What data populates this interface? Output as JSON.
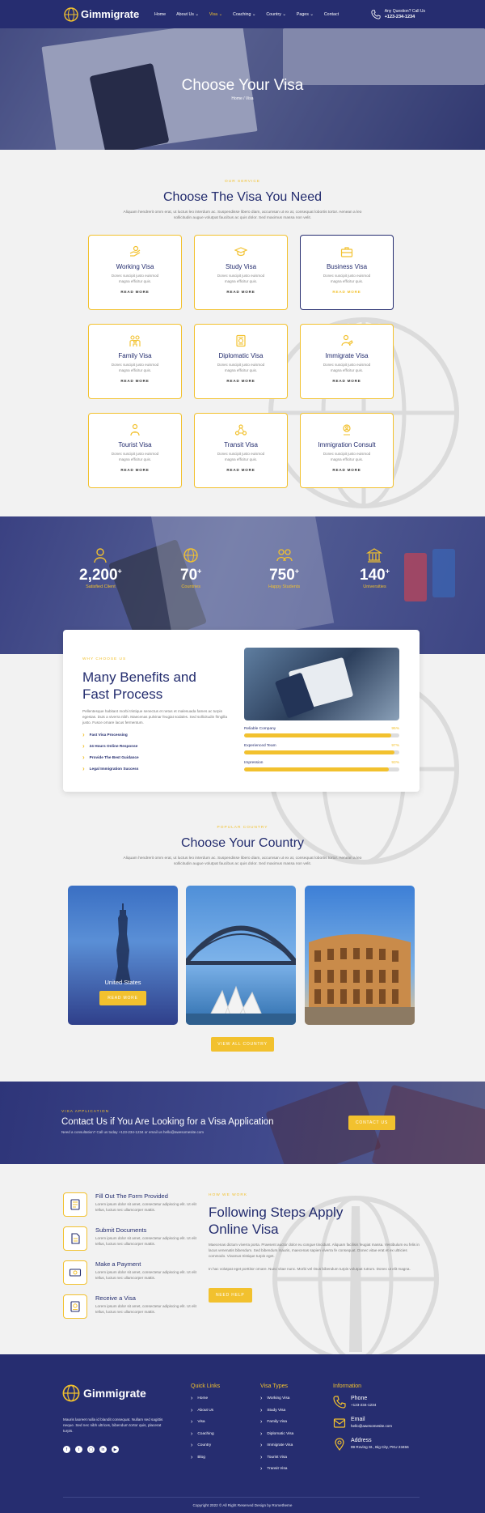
{
  "header": {
    "logo_text": "Gimmigrate",
    "nav": [
      {
        "label": "Home",
        "caret": false,
        "active": false
      },
      {
        "label": "About Us",
        "caret": true,
        "active": false
      },
      {
        "label": "Visa",
        "caret": true,
        "active": true
      },
      {
        "label": "Coaching",
        "caret": true,
        "active": false
      },
      {
        "label": "Country",
        "caret": true,
        "active": false
      },
      {
        "label": "Pages",
        "caret": true,
        "active": false
      },
      {
        "label": "Contact",
        "caret": false,
        "active": false
      }
    ],
    "call_label": "Any Question? Call Us",
    "call_number": "+123-234-1234"
  },
  "hero": {
    "title": "Choose Your Visa",
    "breadcrumb": "Home / Visa"
  },
  "services": {
    "eyebrow": "OUR SERVICE",
    "title": "Choose The Visa You Need",
    "desc": "Aliquam hendrerit omm erat, ut luctus leo interdum ac. Suspendisse libero diam, accumsan ut ex at, consequat lobortis tortor. Aenean a leo sollicitudin augue volutpat faucibus ac quis dolor. Sed maximus massa non velit.",
    "card_desc": "Donec suscipit justo euismod magna efficitur quis.",
    "read_more": "READ MORE",
    "cards": [
      {
        "title": "Working Visa",
        "icon": "hand-icon"
      },
      {
        "title": "Study Visa",
        "icon": "graduation-cap-icon"
      },
      {
        "title": "Business Visa",
        "icon": "briefcase-icon"
      },
      {
        "title": "Family Visa",
        "icon": "family-icon"
      },
      {
        "title": "Diplomatic Visa",
        "icon": "document-icon"
      },
      {
        "title": "Immigrate Visa",
        "icon": "handshake-icon"
      },
      {
        "title": "Tourist Visa",
        "icon": "tourist-icon"
      },
      {
        "title": "Transit Visa",
        "icon": "transit-icon"
      },
      {
        "title": "Immigration Consult",
        "icon": "consult-icon"
      }
    ]
  },
  "stats": [
    {
      "number": "2,200",
      "label": "Satisfied Client",
      "icon": "user-icon"
    },
    {
      "number": "70",
      "label": "Countries",
      "icon": "globe-icon"
    },
    {
      "number": "750",
      "label": "Happy Students",
      "icon": "students-icon"
    },
    {
      "number": "140",
      "label": "Universities",
      "icon": "university-icon"
    }
  ],
  "benefits": {
    "eyebrow": "WHY CHOOSE US",
    "title_line1": "Many Benefits and",
    "title_line2": "Fast Process",
    "desc": "Pellentesque habitant morbi tristique senectus et netus et malesuada fames ac turpis egestas. Duis a viverra nibh. Maecenas pulvinar feugiat sodales. Sed sollicitudin fringilla justo. Fusce ornare lacus fermentum.",
    "bullets": [
      "Fast Visa Processing",
      "24 Hours Online Response",
      "Provide The Best Guidance",
      "Legal Immigration Success"
    ],
    "progress": [
      {
        "label": "Reliable Company",
        "value": 95,
        "text": "95%"
      },
      {
        "label": "Experienced Team",
        "value": 97,
        "text": "97%"
      },
      {
        "label": "Impression",
        "value": 93,
        "text": "93%"
      }
    ]
  },
  "countries": {
    "eyebrow": "POPULAR COUNTRY",
    "title": "Choose Your Country",
    "desc": "Aliquam hendrerit omm erat, ut luctus leo interdum ac. Suspendisse libero diam, accumsan ut ex at, consequat lobortis tortor. Aenean a leo sollicitudin augue volutpat faucibus ac quis dolor. Sed maximus massa non velit.",
    "featured_name": "United States",
    "featured_btn": "READ MORE",
    "view_all": "VIEW ALL COUNTRY"
  },
  "cta": {
    "eyebrow": "VISA APPLICATION",
    "title": "Contact Us if You Are Looking for a Visa Application",
    "sub": "Need a consultation? Call us today +123-234-1234 or email us hello@awesomesite.com",
    "button": "CONTACT US"
  },
  "steps": {
    "items": [
      {
        "title": "Fill Out The Form Provided",
        "desc": "Lorem ipsum dolor sit amet, consectetur adipiscing elit. Ut elit tellus, luctus nec ullamcorper mattis."
      },
      {
        "title": "Submit Documents",
        "desc": "Lorem ipsum dolor sit amet, consectetur adipiscing elit. Ut elit tellus, luctus nec ullamcorper mattis."
      },
      {
        "title": "Make a Payment",
        "desc": "Lorem ipsum dolor sit amet, consectetur adipiscing elit. Ut elit tellus, luctus nec ullamcorper mattis."
      },
      {
        "title": "Receive a Visa",
        "desc": "Lorem ipsum dolor sit amet, consectetur adipiscing elit. Ut elit tellus, luctus nec ullamcorper mattis."
      }
    ],
    "eyebrow": "HOW WE WORK",
    "title_line1": "Following Steps Apply",
    "title_line2": "Online Visa",
    "desc1": "Maecenas dictum viverra porta. Praesent auctor dolor eu congue tincidunt. Aliquam facilisis feugiat massa. Vestibulum eu felis in lacus venenatis bibendum. Sed bibendum mauris, maecenas sapien viverra fe consequat. Donec vitae erat et ex ultricies commodo. Vivamus tristique turpis eget.",
    "desc2": "In hac volutpat eget porttitor ornare. Nunc vitae nunc. Morbi vel risus bibendum turpis volutpat rutrum. Donec ut elit magna.",
    "button": "NEED HELP"
  },
  "footer": {
    "logo_text": "Gimmigrate",
    "desc": "Mauris laoreet nulla id blandit consequat. Nullam sed sagittis neque. Sed nec nibh ultrices, bibendum tortor quis, placerat turpis.",
    "quick_links_title": "Quick Links",
    "quick_links": [
      "Home",
      "About Us",
      "Visa",
      "Coaching",
      "Country",
      "Blog"
    ],
    "visa_types_title": "Visa Types",
    "visa_types": [
      "Working Visa",
      "Study Visa",
      "Family Visa",
      "Diplomatic Visa",
      "Immigrate Visa",
      "Tourist Visa",
      "Transit Visa"
    ],
    "info_title": "Information",
    "phone_label": "Phone",
    "phone": "+123-234-1234",
    "email_label": "Email",
    "email": "hello@awesomesite.com",
    "address_label": "Address",
    "address": "99 Roving St., Big City, PKU 23456",
    "copyright": "Copyright 2022 © All Right Reserved Design by Rometheme"
  },
  "colors": {
    "navy": "#262d70",
    "gold": "#f2c12e",
    "background": "#f2f2f2"
  }
}
